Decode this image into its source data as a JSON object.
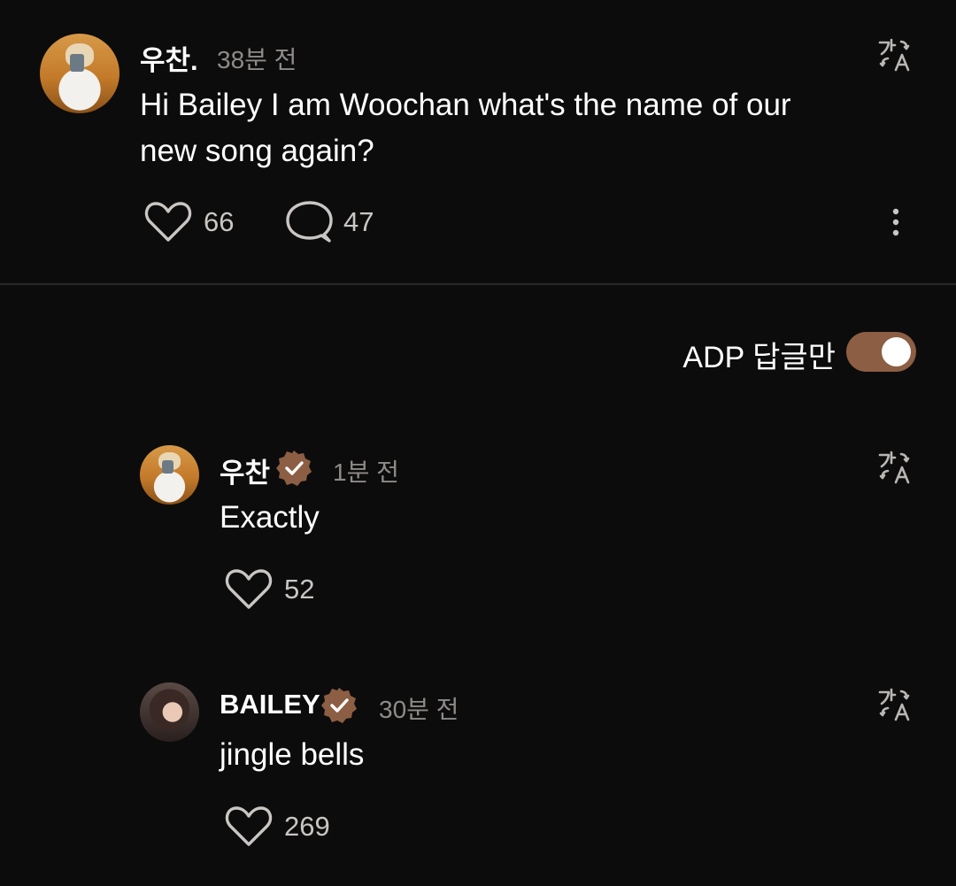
{
  "post": {
    "username": "우찬.",
    "time": "38분 전",
    "text": "Hi Bailey I am Woochan what's the name of our new song again?",
    "likes": "66",
    "comments": "47"
  },
  "filter": {
    "label": "ADP 답글만",
    "enabled": true
  },
  "replies": [
    {
      "username": "우찬",
      "verified": true,
      "time": "1분 전",
      "text": "Exactly",
      "likes": "52"
    },
    {
      "username": "BAILEY",
      "verified": true,
      "time": "30분 전",
      "text": "jingle bells",
      "likes": "269"
    }
  ],
  "colors": {
    "background": "#0d0c0c",
    "accent": "#8c5e44",
    "muted_text": "#8e8b88"
  },
  "icons": {
    "translate": "translate-icon",
    "like": "heart-icon",
    "comment": "comment-bubble-icon",
    "more": "more-vertical-icon",
    "verified": "verified-badge-icon"
  }
}
